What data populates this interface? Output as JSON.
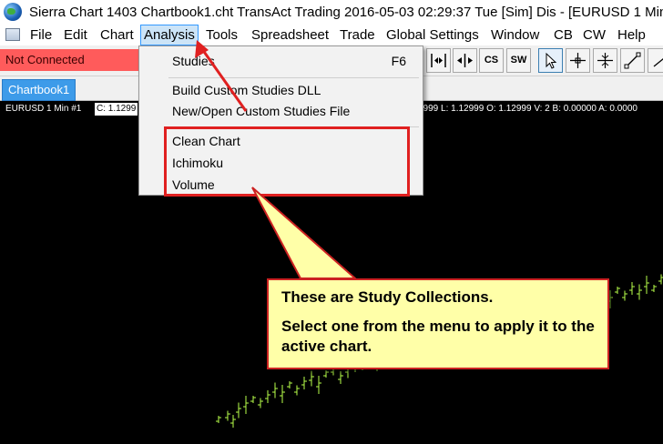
{
  "window": {
    "title": "Sierra Chart 1403 Chartbook1.cht  TransAct Trading 2016-05-03  02:29:37 Tue [Sim]  Dis - [EURUSD  1 Min"
  },
  "menubar": {
    "items": [
      {
        "label": "File"
      },
      {
        "label": "Edit"
      },
      {
        "label": "Chart"
      },
      {
        "label": "Analysis",
        "active": true
      },
      {
        "label": "Tools"
      },
      {
        "label": "Spreadsheet"
      },
      {
        "label": "Trade"
      },
      {
        "label": "Global Settings"
      },
      {
        "label": "Window"
      },
      {
        "label": "CB"
      },
      {
        "label": "CW"
      },
      {
        "label": "Help"
      }
    ]
  },
  "toolbar": {
    "connection_status": "Not Connected",
    "cs_label": "CS",
    "sw_label": "SW",
    "status_color": "#ff5b5b"
  },
  "tabs": [
    {
      "label": "Chartbook1",
      "active": true
    }
  ],
  "chart": {
    "instrument": "EURUSD  1 Min  #1",
    "close_label": "C: 1.1299",
    "ohlc_readout": "2999 L: 1.12999 O: 1.12999 V: 2 B: 0.00000 A: 0.0000",
    "bar_color": "#b8ff4a",
    "down_bar_color": "#ff3030"
  },
  "analysis_menu": {
    "items": [
      {
        "label": "Studies",
        "shortcut": "F6"
      },
      {
        "label": "Build Custom Studies DLL"
      },
      {
        "label": "New/Open Custom Studies File"
      },
      {
        "label": "Clean Chart"
      },
      {
        "label": "Ichimoku"
      },
      {
        "label": "Volume"
      }
    ]
  },
  "callout": {
    "line1": "These are Study Collections.",
    "line2": "Select one from the menu to apply it to the active chart.",
    "annotation_color": "#e02020"
  }
}
